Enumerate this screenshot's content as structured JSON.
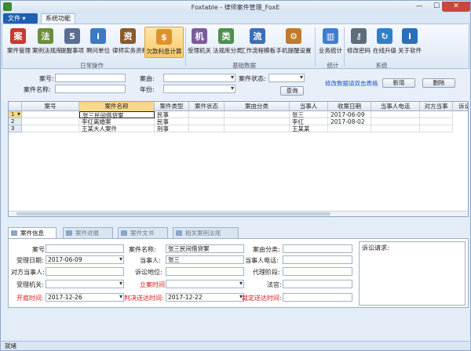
{
  "window": {
    "title": "Foxtable - 律师案件管理_FoxE",
    "min": "—",
    "max": "☐",
    "close": "✕"
  },
  "menubar": {
    "file": "文件 ▾",
    "tab": "系统功能"
  },
  "ribbon": {
    "buttons": [
      {
        "label": "案件管理",
        "icon": "case-icon",
        "color": "#c63a2e",
        "glyph": "案"
      },
      {
        "label": "案例法规库",
        "icon": "law-book-icon",
        "color": "#6b8e3a",
        "glyph": "法"
      },
      {
        "label": "提醒事项",
        "icon": "calendar-icon",
        "color": "#5a6f8f",
        "glyph": "5"
      },
      {
        "label": "聘问单位",
        "icon": "unit-icon",
        "color": "#3a7ac6",
        "glyph": "i"
      },
      {
        "label": "律师实务资料",
        "icon": "books-icon",
        "color": "#8b5a2b",
        "glyph": "资"
      },
      {
        "label": "欠款利息计算",
        "icon": "money-icon",
        "color": "#e0922a",
        "glyph": "$"
      },
      {
        "label": "受理机关",
        "icon": "grid-icon",
        "color": "#7a5c9b",
        "glyph": "机"
      },
      {
        "label": "法规库分类",
        "icon": "category-icon",
        "color": "#4f8f4f",
        "glyph": "类"
      },
      {
        "label": "工作流程模板",
        "icon": "workflow-icon",
        "color": "#3a6fb8",
        "glyph": "流"
      },
      {
        "label": "手机提醒设置",
        "icon": "phone-settings-icon",
        "color": "#c07a2e",
        "glyph": "⚙"
      },
      {
        "label": "业务统计",
        "icon": "bar-chart-icon",
        "color": "#3f7fd0",
        "glyph": "▥"
      },
      {
        "label": "修改密码",
        "icon": "key-icon",
        "color": "#5e6b7a",
        "glyph": "⚷"
      },
      {
        "label": "在线升级",
        "icon": "refresh-icon",
        "color": "#2f80c8",
        "glyph": "↻"
      },
      {
        "label": "关于软件",
        "icon": "info-icon",
        "color": "#2c6fb8",
        "glyph": "i"
      }
    ],
    "groups": [
      "日常操作",
      "基础数据",
      "统计",
      "系统"
    ]
  },
  "search": {
    "case_no_label": "案号:",
    "case_name_label": "案件名称:",
    "cause_label": "案由:",
    "year_label": "年份:",
    "status_label": "案件状态:",
    "query_button": "查询",
    "edit_hint": "修改数据请双击表格",
    "new_button": "新增",
    "delete_button": "删除"
  },
  "grid": {
    "columns": [
      "案号",
      "案件名称",
      "案件类型",
      "案件状态",
      "案由分类",
      "当事人",
      "收案日期",
      "当事人电话",
      "对方当事",
      "诉讼"
    ],
    "rows": [
      {
        "num": "1",
        "case_no": "",
        "name": "张三民间借贷案",
        "type": "民事",
        "status": "",
        "cause": "",
        "party": "张三",
        "date": "2017-06-09",
        "phone": "",
        "opp": ""
      },
      {
        "num": "2",
        "case_no": "",
        "name": "李红离婚案",
        "type": "民事",
        "status": "",
        "cause": "",
        "party": "李红",
        "date": "2017-08-02",
        "phone": "",
        "opp": ""
      },
      {
        "num": "3",
        "case_no": "",
        "name": "王某大人案件",
        "type": "刑事",
        "status": "",
        "cause": "",
        "party": "王某某",
        "date": "",
        "phone": "",
        "opp": ""
      }
    ]
  },
  "tabs": [
    "案件信息",
    "案件进展",
    "案件文书",
    "相关案例法规"
  ],
  "detail": {
    "case_no_label": "案号:",
    "case_no": "",
    "case_name_label": "案件名称:",
    "case_name": "张三民间借贷案",
    "cause_label": "案由分类:",
    "cause": "",
    "accept_date_label": "受理日期:",
    "accept_date": "2017-06-09",
    "party_label": "当事人:",
    "party": "张三",
    "party_phone_label": "当事人电话:",
    "party_phone": "",
    "opp_label": "对方当事人:",
    "opp": "",
    "lit_pos_label": "诉讼地位:",
    "lit_pos": "",
    "agent_stage_label": "代理阶段:",
    "agent_stage": "",
    "authority_label": "受理机关:",
    "authority": "",
    "filing_label": "立案时间:",
    "filing": "",
    "judge_label": "法官:",
    "judge": "",
    "hearing_label": "开庭时间:",
    "hearing": "2017-12-26",
    "judgment_label": "判决送达时间:",
    "judgment": "2017-12-22",
    "ruling_label": "裁定送达时间:",
    "ruling": "",
    "notes_label": "诉讼请求:"
  },
  "status": "就绪"
}
